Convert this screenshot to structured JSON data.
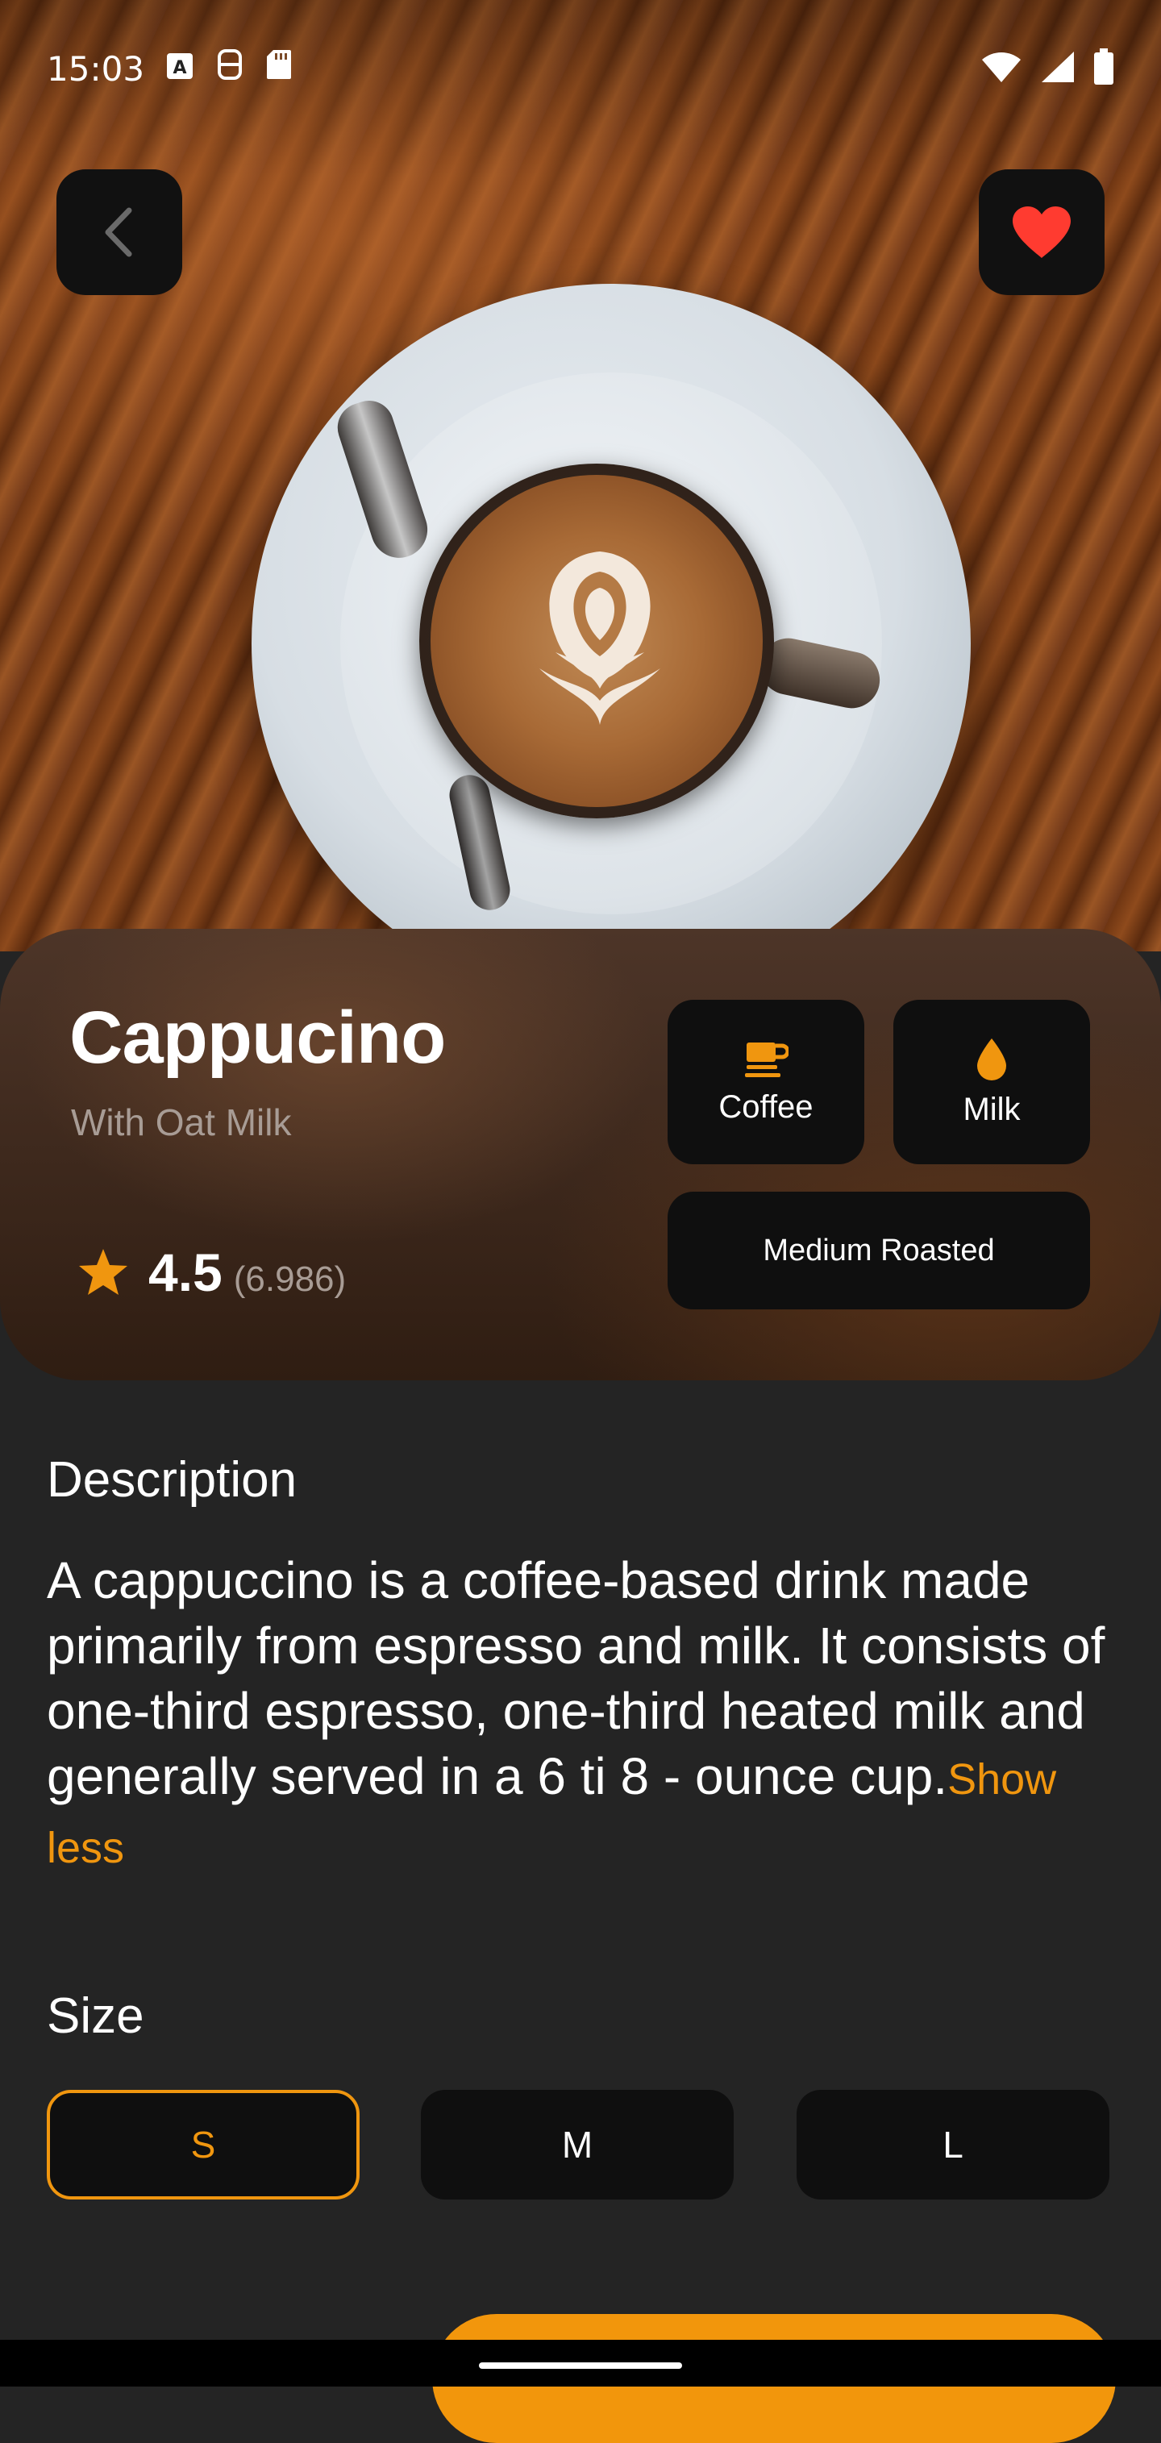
{
  "status_bar": {
    "time": "15:03",
    "icons_left": [
      "a-box-icon",
      "sim-icon",
      "sd-card-icon"
    ],
    "icons_right": [
      "wifi-icon",
      "signal-icon",
      "battery-icon"
    ]
  },
  "header": {
    "back_icon": "chevron-left-icon",
    "favorite_icon": "heart-icon",
    "favorite_color": "#ff3b30"
  },
  "product": {
    "name": "Cappucino",
    "subtitle": "With Oat Milk",
    "rating": "4.5",
    "rating_count": "(6.986)",
    "rating_icon": "star-icon"
  },
  "chips": {
    "coffee_label": "Coffee",
    "coffee_icon": "coffee-cup-icon",
    "milk_label": "Milk",
    "milk_icon": "drop-icon",
    "roast_label": "Medium Roasted"
  },
  "description": {
    "title": "Description",
    "text": "A cappuccino is a coffee-based drink made primarily from espresso and milk. It consists of one-third espresso, one-third heated milk and generally served in a 6 ti 8 - ounce cup.",
    "toggle_label": "Show less"
  },
  "size": {
    "title": "Size",
    "options": [
      "S",
      "M",
      "L"
    ],
    "selected": "S"
  },
  "colors": {
    "accent": "#f0960f",
    "background": "#242424",
    "chip_bg": "#0f0f0f"
  }
}
